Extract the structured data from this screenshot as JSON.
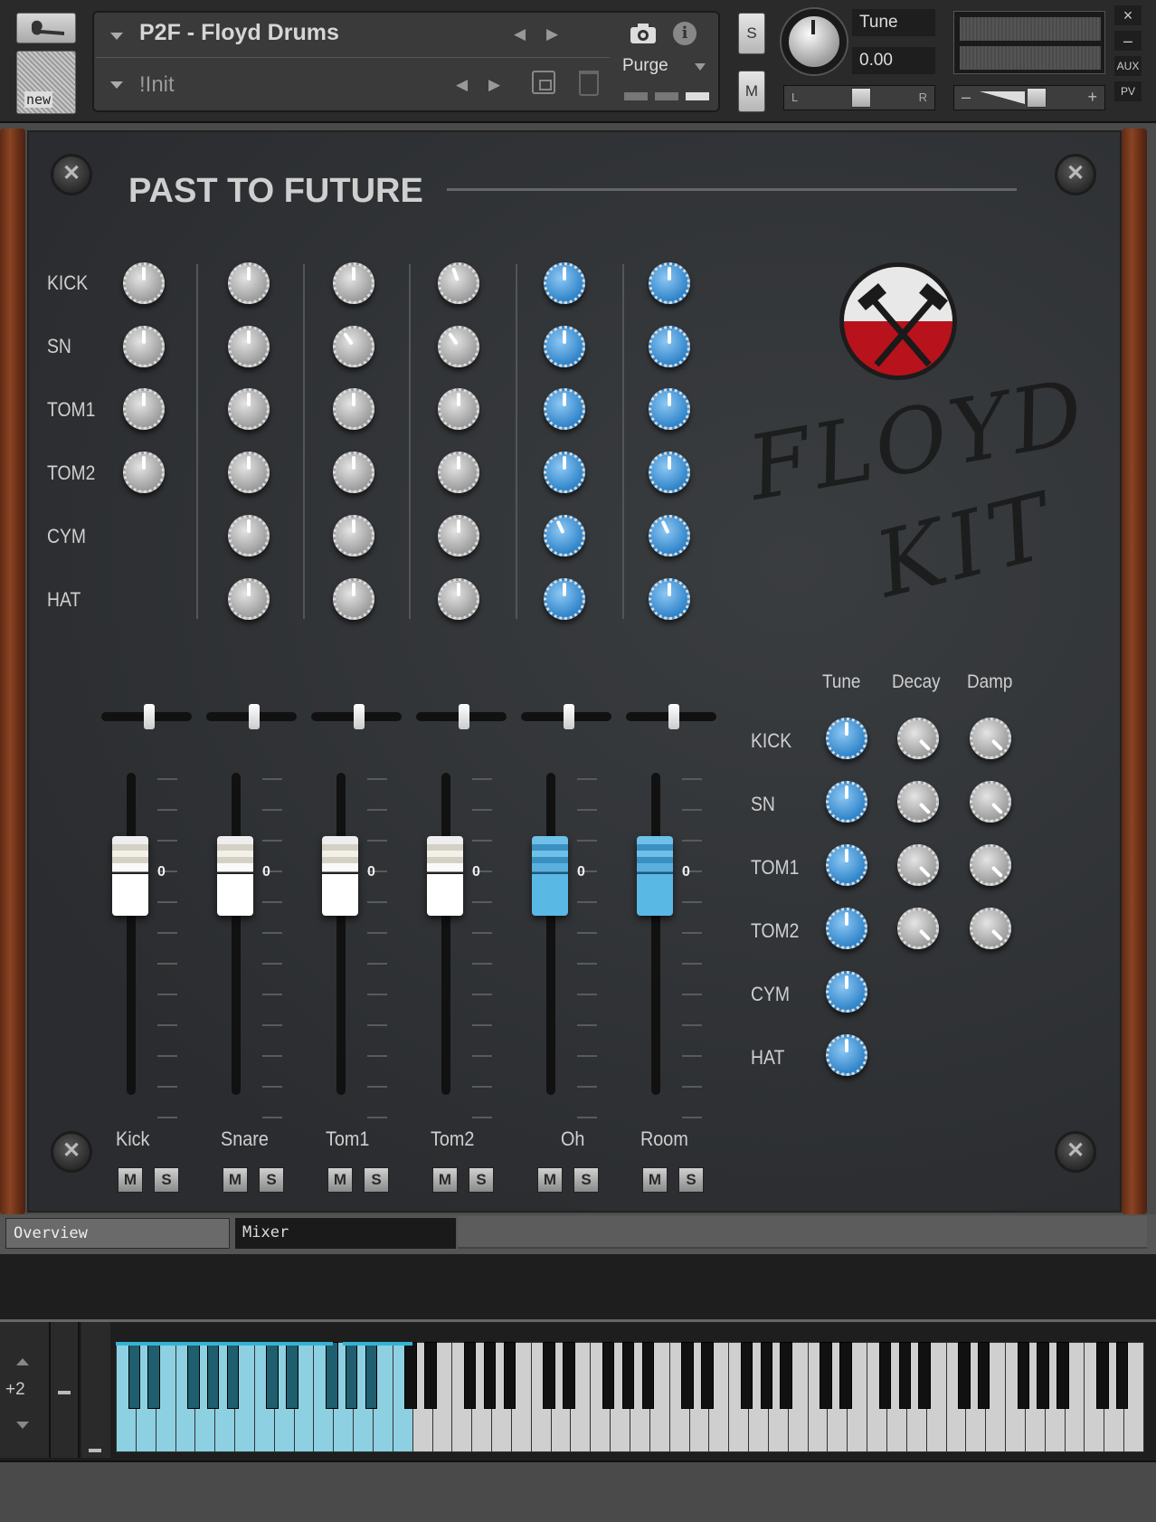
{
  "header": {
    "instrument_name": "P2F - Floyd Drums",
    "preset_name": "!Init",
    "new_label": "new",
    "purge_label": "Purge",
    "solo_label": "S",
    "mute_label": "M",
    "tune_label": "Tune",
    "tune_value": "0.00",
    "pan_left": "L",
    "pan_right": "R",
    "vol_minus": "–",
    "vol_plus": "+",
    "aux_label": "AUX",
    "pv_label": "PV",
    "close_label": "×",
    "minimize_label": "–",
    "info_label": "i"
  },
  "panel": {
    "title": "PAST TO FUTURE",
    "logo_line1": "FLOYD",
    "logo_line2": "KIT"
  },
  "matrix": {
    "row_labels": [
      "KICK",
      "SN",
      "TOM1",
      "TOM2",
      "CYM",
      "HAT"
    ]
  },
  "mixer": {
    "channels": [
      "Kick",
      "Snare",
      "Tom1",
      "Tom2",
      "Oh",
      "Room"
    ],
    "fader_value": "0",
    "mute_label": "M",
    "solo_label": "S"
  },
  "params": {
    "headers": [
      "Tune",
      "Decay",
      "Damp"
    ],
    "row_labels": [
      "KICK",
      "SN",
      "TOM1",
      "TOM2",
      "CYM",
      "HAT"
    ]
  },
  "tabs": {
    "overview": "Overview",
    "mixer": "Mixer"
  },
  "keyboard": {
    "octave_offset": "+2"
  },
  "colors": {
    "accent_blue": "#2d82c8",
    "key_highlight": "#8dd0e2",
    "logo_red": "#b8121c",
    "wood": "#8a4424"
  }
}
